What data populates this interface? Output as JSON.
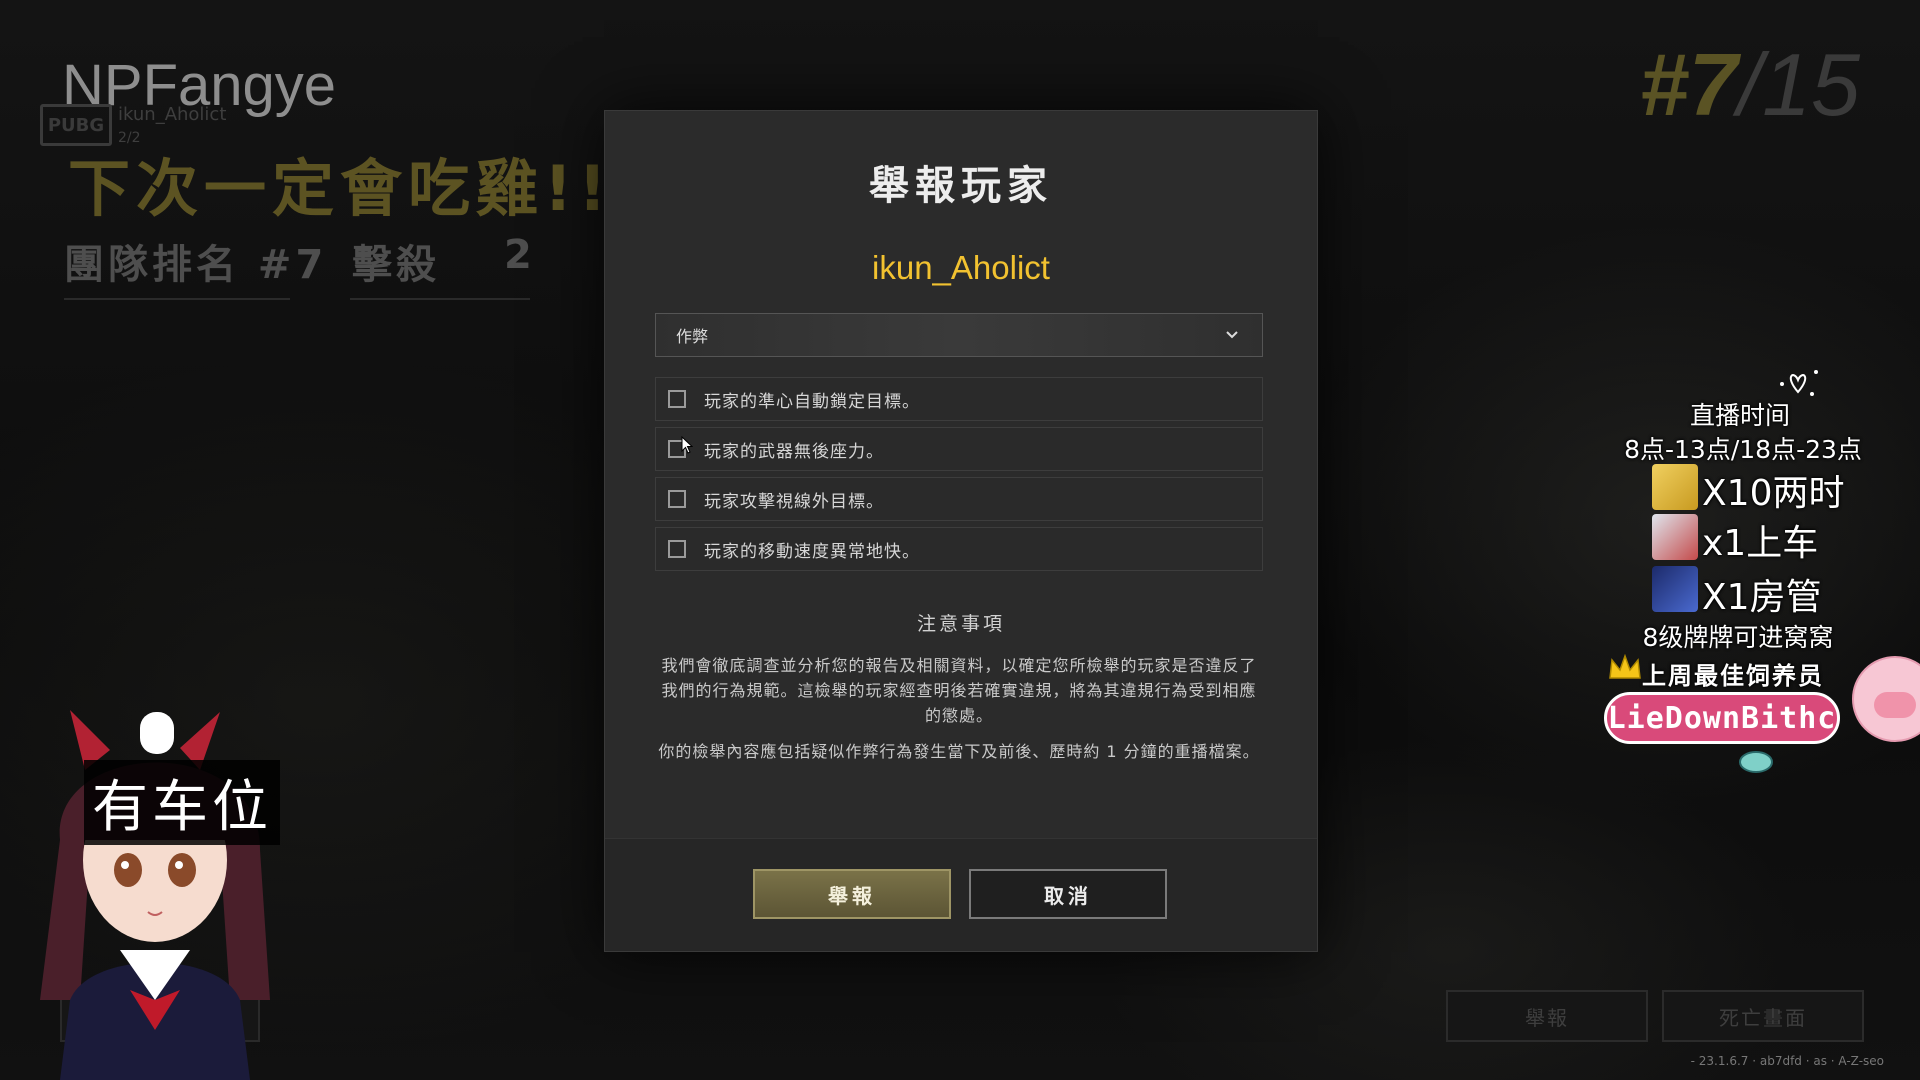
{
  "background": {
    "player_name": "NPFangye",
    "sub_name": "ikun_Aholict",
    "sub_status": "2/2",
    "logo_text": "PUBG",
    "headline": "下次一定會吃雞!!",
    "team_rank_label": "團隊排名 #7",
    "kills_label": "擊殺",
    "kills_value": "2",
    "rank_number": "#7",
    "rank_total": "/15",
    "report_button": "舉報",
    "death_cam_button": "死亡畫面",
    "version": "- 23.1.6.7 · ab7dfd · as · A-Z-seo"
  },
  "modal": {
    "title": "舉報玩家",
    "player": "ikun_Aholict",
    "reason_selected": "作弊",
    "options": [
      {
        "label": "玩家的準心自動鎖定目標。",
        "checked": false
      },
      {
        "label": "玩家的武器無後座力。",
        "checked": false
      },
      {
        "label": "玩家攻擊視線外目標。",
        "checked": false
      },
      {
        "label": "玩家的移動速度異常地快。",
        "checked": false
      }
    ],
    "notice_title": "注意事項",
    "notice_p1": "我們會徹底調查並分析您的報告及相關資料，以確定您所檢舉的玩家是否違反了我們的行為規範。這檢舉的玩家經查明後若確實違規，將為其違規行為受到相應的懲處。",
    "notice_p2": "你的檢舉內容應包括疑似作弊行為發生當下及前後、歷時約 1 分鐘的重播檔案。",
    "report_button": "舉報",
    "cancel_button": "取消"
  },
  "stream_overlay": {
    "schedule_title": "直播时间",
    "schedule_hours": "8点-13点/18点-23点",
    "gift_1": "X10两时",
    "gift_2": "x1上车",
    "gift_3": "X1房管",
    "fan_level": "8级牌牌可进窝窝",
    "best_feeder_label": "上周最佳饲养员",
    "best_feeder_name": "LieDownBithc",
    "vtuber_caption": "有车位"
  },
  "colors": {
    "accent_yellow": "#f2c230",
    "report_button": "#6b6340",
    "pill_pink": "#d94a7a"
  }
}
